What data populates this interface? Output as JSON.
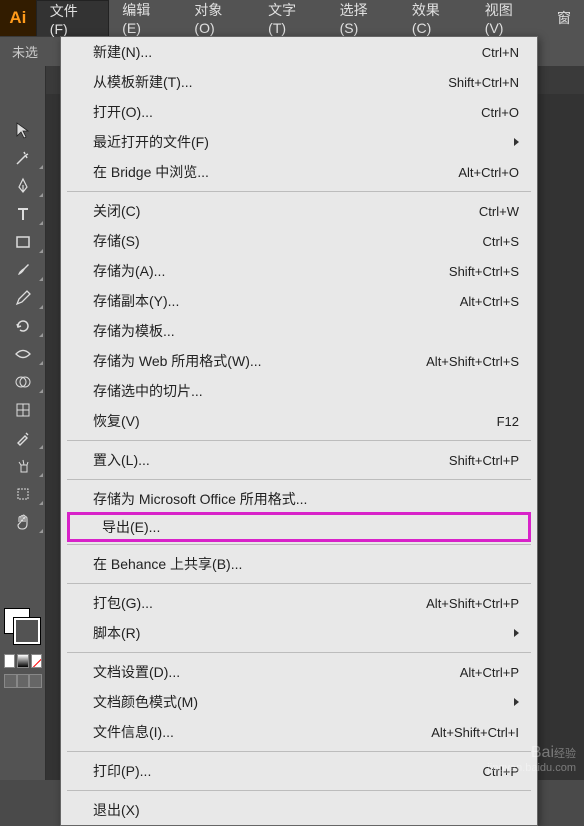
{
  "logo": "Ai",
  "menubar": {
    "file": "文件(F)",
    "edit": "编辑(E)",
    "object": "对象(O)",
    "type": "文字(T)",
    "select": "选择(S)",
    "effect": "效果(C)",
    "view": "视图(V)",
    "window": "窗"
  },
  "subbar": {
    "no_selection": "未选"
  },
  "tab_close": "×",
  "file_menu": {
    "new": {
      "label": "新建(N)...",
      "shortcut": "Ctrl+N"
    },
    "new_template": {
      "label": "从模板新建(T)...",
      "shortcut": "Shift+Ctrl+N"
    },
    "open": {
      "label": "打开(O)...",
      "shortcut": "Ctrl+O"
    },
    "recent": {
      "label": "最近打开的文件(F)",
      "shortcut": ""
    },
    "browse_bridge": {
      "label": "在 Bridge 中浏览...",
      "shortcut": "Alt+Ctrl+O"
    },
    "close": {
      "label": "关闭(C)",
      "shortcut": "Ctrl+W"
    },
    "save": {
      "label": "存储(S)",
      "shortcut": "Ctrl+S"
    },
    "save_as": {
      "label": "存储为(A)...",
      "shortcut": "Shift+Ctrl+S"
    },
    "save_copy": {
      "label": "存储副本(Y)...",
      "shortcut": "Alt+Ctrl+S"
    },
    "save_template": {
      "label": "存储为模板...",
      "shortcut": ""
    },
    "save_web": {
      "label": "存储为 Web 所用格式(W)...",
      "shortcut": "Alt+Shift+Ctrl+S"
    },
    "save_slices": {
      "label": "存储选中的切片...",
      "shortcut": ""
    },
    "revert": {
      "label": "恢复(V)",
      "shortcut": "F12"
    },
    "place": {
      "label": "置入(L)...",
      "shortcut": "Shift+Ctrl+P"
    },
    "save_ms_office": {
      "label": "存储为 Microsoft Office 所用格式...",
      "shortcut": ""
    },
    "export": {
      "label": "导出(E)...",
      "shortcut": ""
    },
    "share_behance": {
      "label": "在 Behance 上共享(B)...",
      "shortcut": ""
    },
    "package": {
      "label": "打包(G)...",
      "shortcut": "Alt+Shift+Ctrl+P"
    },
    "scripts": {
      "label": "脚本(R)",
      "shortcut": ""
    },
    "doc_setup": {
      "label": "文档设置(D)...",
      "shortcut": "Alt+Ctrl+P"
    },
    "color_mode": {
      "label": "文档颜色模式(M)",
      "shortcut": ""
    },
    "file_info": {
      "label": "文件信息(I)...",
      "shortcut": "Alt+Shift+Ctrl+I"
    },
    "print": {
      "label": "打印(P)...",
      "shortcut": "Ctrl+P"
    },
    "exit": {
      "label": "退出(X)",
      "shortcut": ""
    }
  },
  "watermark": {
    "logo": "Bai",
    "suffix": "经验",
    "url": "jingyan.baidu.com"
  }
}
